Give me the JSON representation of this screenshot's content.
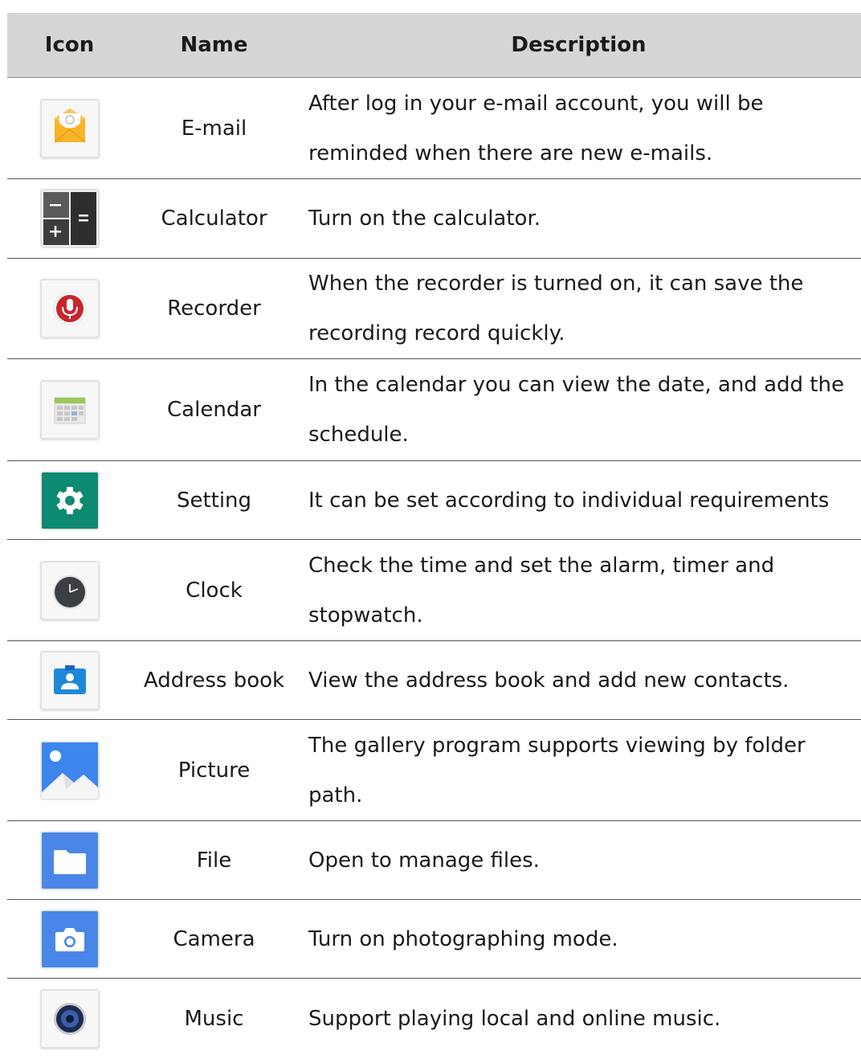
{
  "header": {
    "icon": "Icon",
    "name": "Name",
    "description": "Description"
  },
  "rows": [
    {
      "icon": "email-icon",
      "name": "E-mail",
      "description": "After log in your e-mail account, you will be reminded when there are new e-mails."
    },
    {
      "icon": "calculator-icon",
      "name": "Calculator",
      "description": "Turn on the calculator."
    },
    {
      "icon": "microphone-icon",
      "name": "Recorder",
      "description": "When the recorder is turned on, it can save the recording record quickly."
    },
    {
      "icon": "calendar-icon",
      "name": "Calendar",
      "description": "In the calendar you can view the date, and add the schedule."
    },
    {
      "icon": "gear-icon",
      "name": "Setting",
      "description": "It can be set according to individual requirements"
    },
    {
      "icon": "clock-icon",
      "name": "Clock",
      "description": "Check the time and set the alarm, timer and stopwatch."
    },
    {
      "icon": "contacts-icon",
      "name": "Address book",
      "description": "View the address book and add new contacts."
    },
    {
      "icon": "picture-icon",
      "name": "Picture",
      "description": "The gallery program supports viewing by folder path."
    },
    {
      "icon": "folder-icon",
      "name": "File",
      "description": "Open to manage files."
    },
    {
      "icon": "camera-icon",
      "name": "Camera",
      "description": "Turn on photographing mode."
    },
    {
      "icon": "speaker-icon",
      "name": "Music",
      "description": "Support playing local and online music."
    }
  ]
}
